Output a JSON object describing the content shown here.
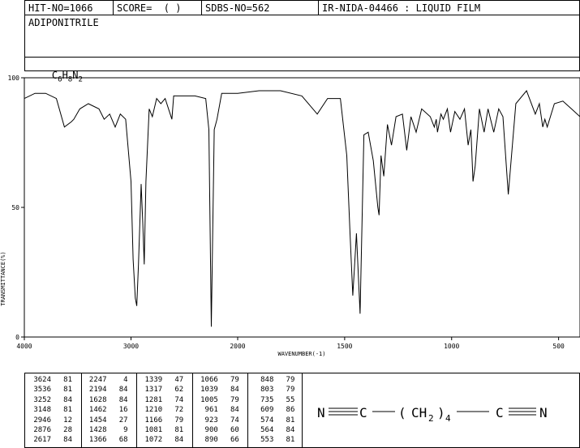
{
  "header": {
    "hit_no": "HIT-NO=1066",
    "score": "SCORE=  ( )",
    "sdbs_no": "SDBS-NO=562",
    "ir_id": "IR-NIDA-04466 : LIQUID FILM"
  },
  "compound_name": "ADIPONITRILE",
  "formula": {
    "c": "C",
    "c_sub": "6",
    "h": "H",
    "h_sub": "8",
    "n": "N",
    "n_sub": "2"
  },
  "structure": {
    "n1": "N",
    "c1": "C",
    "open_paren": "(",
    "ch2": "CH",
    "ch2_sub": "2",
    "close_paren": ")",
    "repeat": "4",
    "c2": "C",
    "n2": "N"
  },
  "chart_data": {
    "type": "line",
    "xlabel": "WAVENUMBER(-1)",
    "ylabel": "TRANSMITTANCE(%)",
    "xlim": [
      4000,
      400
    ],
    "ylim": [
      0,
      100
    ],
    "x_ticks": [
      "4000",
      "3000",
      "2000",
      "1500",
      "1000",
      "500"
    ],
    "y_ticks": [
      "100",
      "50",
      "0"
    ],
    "x": [
      4000,
      3900,
      3800,
      3700,
      3624,
      3560,
      3536,
      3480,
      3400,
      3300,
      3252,
      3200,
      3148,
      3100,
      3050,
      3000,
      2980,
      2960,
      2946,
      2930,
      2905,
      2890,
      2876,
      2860,
      2830,
      2800,
      2760,
      2720,
      2680,
      2617,
      2600,
      2500,
      2400,
      2300,
      2270,
      2247,
      2220,
      2194,
      2150,
      2100,
      2000,
      1900,
      1800,
      1700,
      1628,
      1580,
      1520,
      1490,
      1475,
      1462,
      1454,
      1445,
      1428,
      1410,
      1390,
      1366,
      1345,
      1339,
      1330,
      1317,
      1300,
      1281,
      1260,
      1230,
      1210,
      1190,
      1166,
      1140,
      1100,
      1081,
      1072,
      1066,
      1050,
      1039,
      1020,
      1005,
      985,
      961,
      940,
      923,
      910,
      900,
      890,
      870,
      848,
      830,
      803,
      780,
      760,
      735,
      700,
      650,
      609,
      590,
      574,
      564,
      553,
      520,
      480,
      440,
      400
    ],
    "y": [
      92,
      94,
      94,
      92,
      81,
      83,
      84,
      88,
      90,
      88,
      84,
      86,
      81,
      86,
      84,
      60,
      30,
      15,
      12,
      28,
      59,
      44,
      28,
      60,
      88,
      85,
      92,
      90,
      92,
      84,
      93,
      93,
      93,
      92,
      80,
      4,
      80,
      84,
      94,
      94,
      94,
      95,
      95,
      93,
      86,
      92,
      92,
      70,
      40,
      16,
      27,
      40,
      9,
      78,
      79,
      68,
      50,
      47,
      70,
      62,
      82,
      74,
      85,
      86,
      72,
      85,
      79,
      88,
      85,
      81,
      84,
      79,
      86,
      84,
      88,
      79,
      87,
      84,
      88,
      74,
      80,
      60,
      66,
      88,
      79,
      88,
      79,
      88,
      85,
      55,
      90,
      95,
      86,
      90,
      81,
      84,
      81,
      90,
      91,
      88,
      85
    ]
  },
  "peak_table": [
    [
      [
        "3624",
        "81"
      ],
      [
        "3536",
        "81"
      ],
      [
        "3252",
        "84"
      ],
      [
        "3148",
        "81"
      ],
      [
        "2946",
        "12"
      ],
      [
        "2876",
        "28"
      ],
      [
        "2617",
        "84"
      ]
    ],
    [
      [
        "2247",
        "4"
      ],
      [
        "2194",
        "84"
      ],
      [
        "1628",
        "84"
      ],
      [
        "1462",
        "16"
      ],
      [
        "1454",
        "27"
      ],
      [
        "1428",
        "9"
      ],
      [
        "1366",
        "68"
      ]
    ],
    [
      [
        "1339",
        "47"
      ],
      [
        "1317",
        "62"
      ],
      [
        "1281",
        "74"
      ],
      [
        "1210",
        "72"
      ],
      [
        "1166",
        "79"
      ],
      [
        "1081",
        "81"
      ],
      [
        "1072",
        "84"
      ]
    ],
    [
      [
        "1066",
        "79"
      ],
      [
        "1039",
        "84"
      ],
      [
        "1005",
        "79"
      ],
      [
        "961",
        "84"
      ],
      [
        "923",
        "74"
      ],
      [
        "900",
        "60"
      ],
      [
        "890",
        "66"
      ]
    ],
    [
      [
        "848",
        "79"
      ],
      [
        "803",
        "79"
      ],
      [
        "735",
        "55"
      ],
      [
        "609",
        "86"
      ],
      [
        "574",
        "81"
      ],
      [
        "564",
        "84"
      ],
      [
        "553",
        "81"
      ]
    ]
  ]
}
